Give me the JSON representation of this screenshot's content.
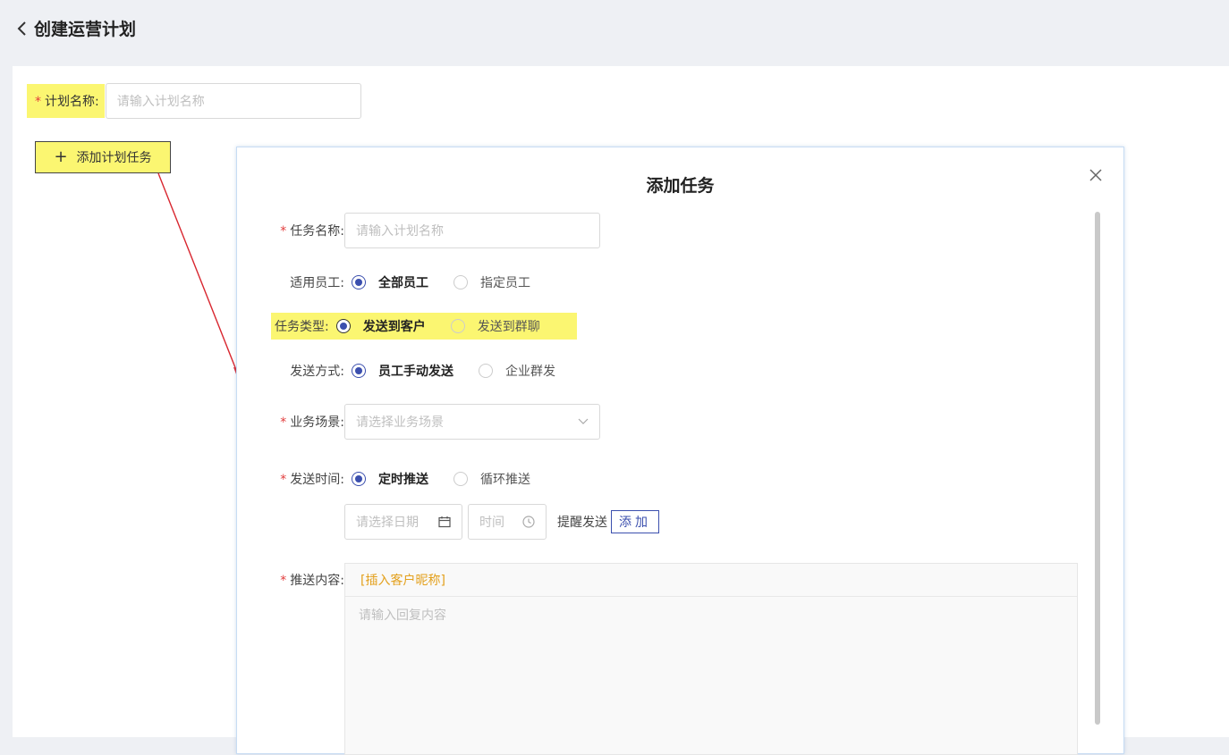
{
  "header": {
    "title": "创建运营计划"
  },
  "plan": {
    "required_mark": "*",
    "name_label": "计划名称:",
    "name_placeholder": "请输入计划名称",
    "add_task_label": "添加计划任务",
    "add_task_icon": "plus-icon"
  },
  "dialog": {
    "title": "添加任务",
    "close_icon": "close-icon",
    "task_name": {
      "required_mark": "*",
      "label": "任务名称:",
      "placeholder": "请输入计划名称"
    },
    "staff": {
      "label": "适用员工:",
      "options": [
        {
          "label": "全部员工",
          "checked": true
        },
        {
          "label": "指定员工",
          "checked": false
        }
      ]
    },
    "task_type": {
      "label": "任务类型:",
      "options": [
        {
          "label": "发送到客户",
          "checked": true
        },
        {
          "label": "发送到群聊",
          "checked": false
        }
      ]
    },
    "send_method": {
      "label": "发送方式:",
      "options": [
        {
          "label": "员工手动发送",
          "checked": true
        },
        {
          "label": "企业群发",
          "checked": false
        }
      ]
    },
    "scene": {
      "required_mark": "*",
      "label": "业务场景:",
      "placeholder": "请选择业务场景"
    },
    "send_time": {
      "required_mark": "*",
      "label": "发送时间:",
      "options": [
        {
          "label": "定时推送",
          "checked": true
        },
        {
          "label": "循环推送",
          "checked": false
        }
      ],
      "date_placeholder": "请选择日期",
      "time_placeholder": "时间",
      "remind_label": "提醒发送",
      "add_button": "添加"
    },
    "content": {
      "required_mark": "*",
      "label": "推送内容:",
      "insert_nickname": "[插入客户昵称]",
      "placeholder": "请输入回复内容"
    }
  },
  "colors": {
    "accent": "#3b4fae",
    "highlight": "#fbf671",
    "required": "#e23c3c",
    "insert_link": "#e3a01c",
    "annotation_arrow": "#d8262f"
  }
}
